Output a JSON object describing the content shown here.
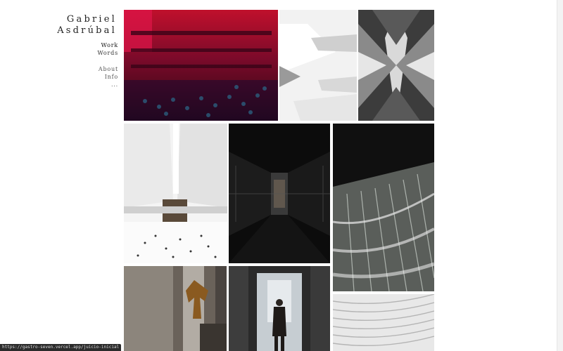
{
  "site": {
    "first_name": "Gabriel",
    "last_name": "Asdrúbal"
  },
  "nav": {
    "primary": [
      {
        "label": "Work"
      },
      {
        "label": "Words"
      }
    ],
    "secondary": [
      {
        "label": "About"
      },
      {
        "label": "Info"
      }
    ],
    "more": "..."
  },
  "status_url": "https://gastro-seven.vercel.app/juicio-inicial",
  "gallery": [
    {
      "name": "concert-hall-photo",
      "subject": "concert hall audience red and blue light"
    },
    {
      "name": "spiral-museum-photo",
      "subject": "white spiral architecture"
    },
    {
      "name": "symmetric-structure-photo",
      "subject": "symmetrical steel structure"
    },
    {
      "name": "oculus-hall-photo",
      "subject": "white ribbed station hall with people"
    },
    {
      "name": "dark-corridor-photo",
      "subject": "dark glass corridor reflections"
    },
    {
      "name": "glass-facade-photo",
      "subject": "curved glass building interior"
    },
    {
      "name": "angel-sculpture-photo",
      "subject": "golden winged statue in corridor"
    },
    {
      "name": "hallway-person-photo",
      "subject": "person walking down hallway"
    },
    {
      "name": "ribs-pattern-photo",
      "subject": "white ribbed pattern"
    }
  ]
}
